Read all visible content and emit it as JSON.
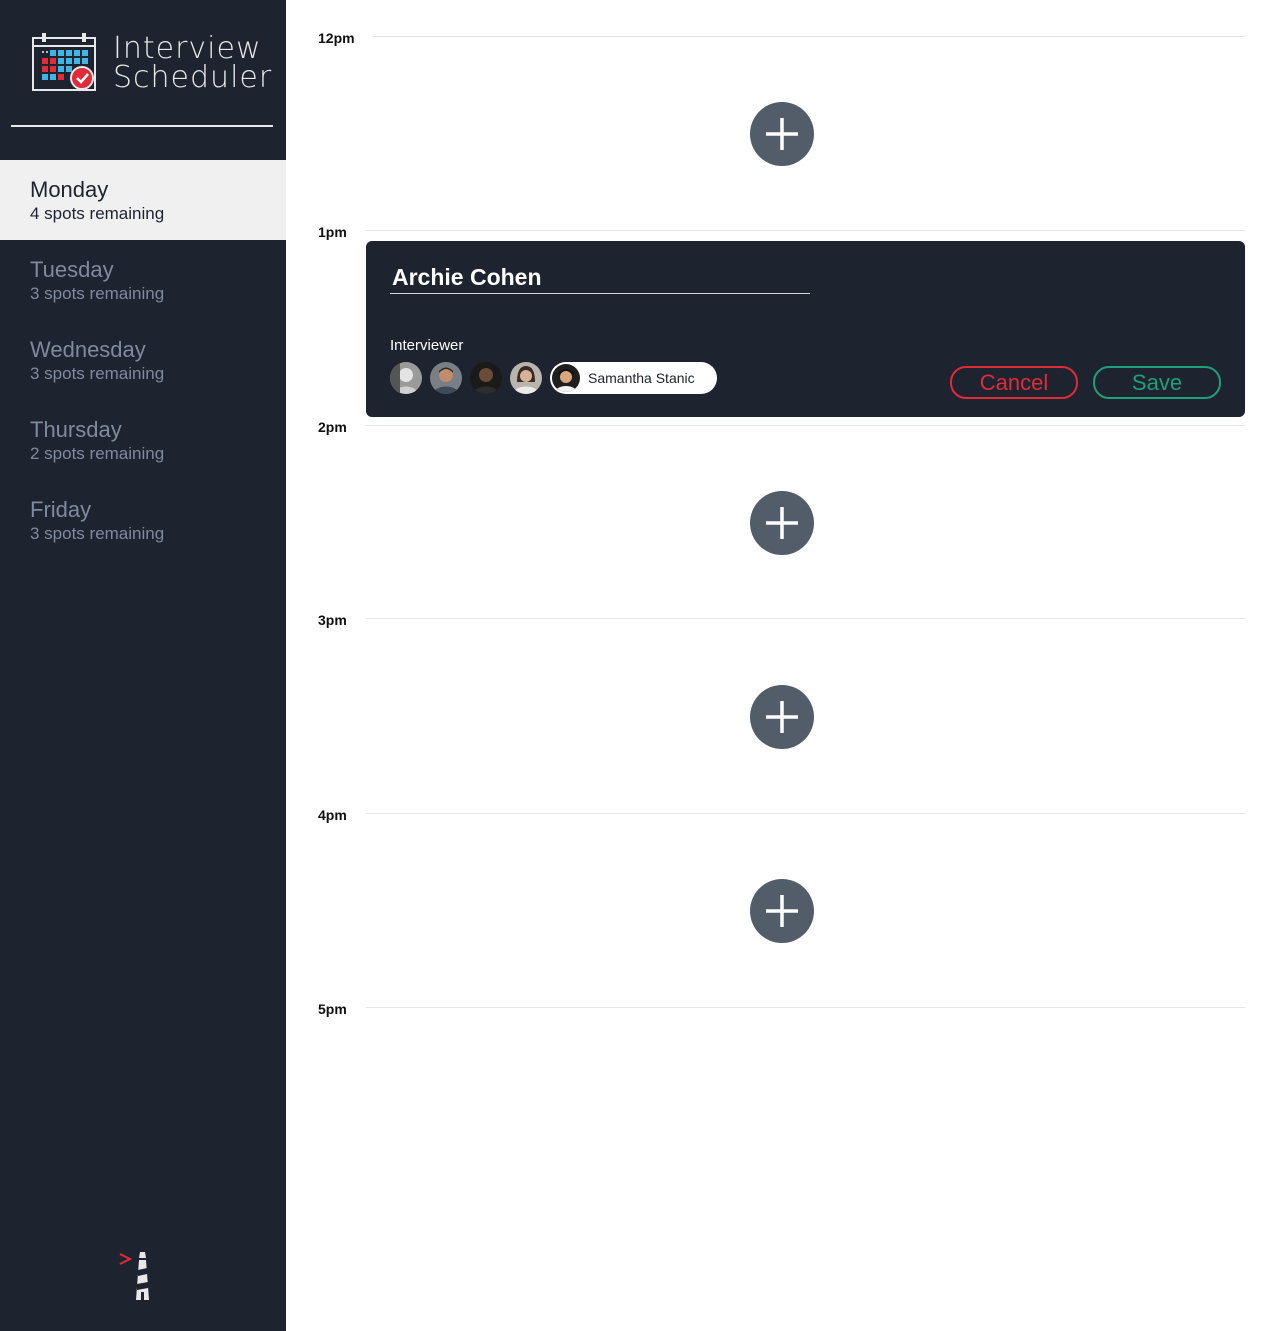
{
  "app": {
    "title_line1": "Interview",
    "title_line2": "Scheduler"
  },
  "sidebar": {
    "days": [
      {
        "name": "Monday",
        "spots": "4 spots remaining",
        "selected": true
      },
      {
        "name": "Tuesday",
        "spots": "3 spots remaining",
        "selected": false
      },
      {
        "name": "Wednesday",
        "spots": "3 spots remaining",
        "selected": false
      },
      {
        "name": "Thursday",
        "spots": "2 spots remaining",
        "selected": false
      },
      {
        "name": "Friday",
        "spots": "3 spots remaining",
        "selected": false
      }
    ]
  },
  "schedule": {
    "hours": [
      "12pm",
      "1pm",
      "2pm",
      "3pm",
      "4pm",
      "5pm"
    ]
  },
  "form": {
    "student_name": "Archie Cohen",
    "interviewer_label": "Interviewer",
    "selected_interviewer": "Samantha Stanic",
    "cancel_label": "Cancel",
    "save_label": "Save"
  },
  "icons": {
    "logo": "calendar-check-icon",
    "add": "plus-icon",
    "footer": "lighthouse-icon"
  },
  "colors": {
    "sidebar_bg": "#1e2330",
    "add_button": "#535d69",
    "cancel": "#e02b38",
    "save": "#1f9e7a"
  }
}
